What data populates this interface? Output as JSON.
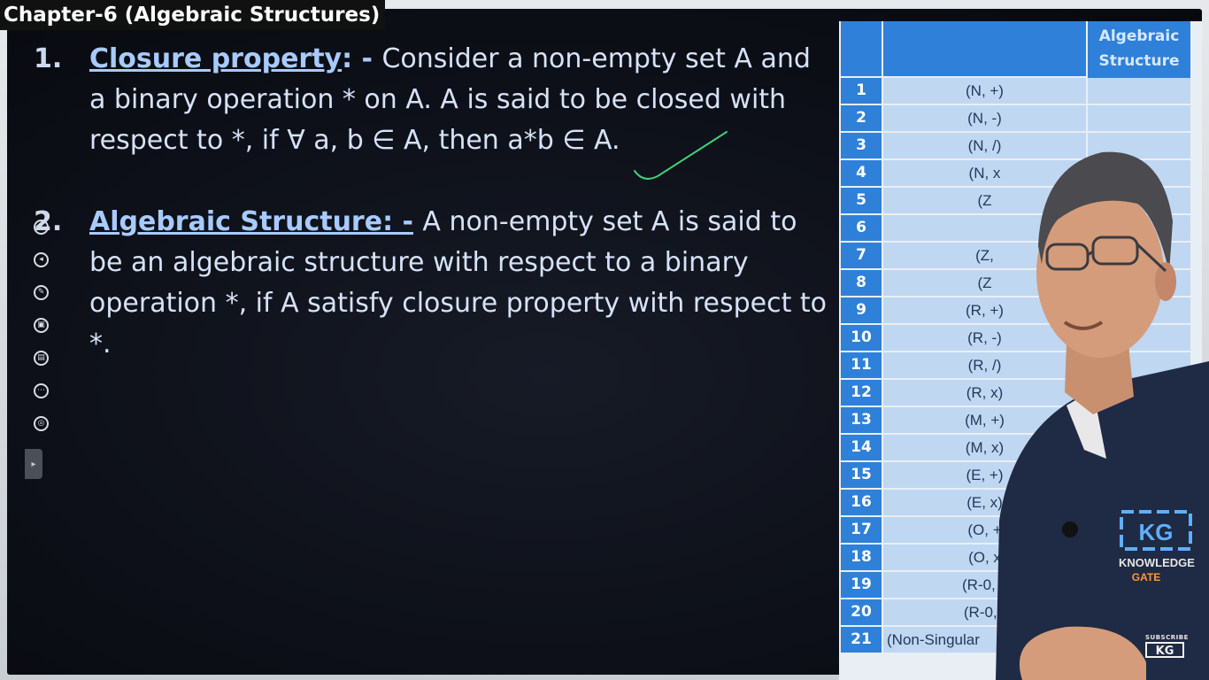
{
  "chapter_title": "Chapter-6 (Algebraic Structures)",
  "items": [
    {
      "number": "1.",
      "term": "Closure property",
      "separator": ": - ",
      "text": "Consider a non-empty set A and a binary operation * on A. A is said to be closed with respect to *, if ∀ a, b ∈ A, then a*b ∈ A."
    },
    {
      "number": "2.",
      "term": "Algebraic Structure: -",
      "separator": " ",
      "text": "A non-empty set A is said to be an algebraic structure with respect to a binary operation *, if A satisfy closure property with respect to *."
    }
  ],
  "table": {
    "header": {
      "num": "",
      "set": "",
      "structure": "Algebraic Structure"
    },
    "rows": [
      {
        "num": "1",
        "set": "(N, +)"
      },
      {
        "num": "2",
        "set": "(N, -)"
      },
      {
        "num": "3",
        "set": "(N, /)"
      },
      {
        "num": "4",
        "set": "(N, x"
      },
      {
        "num": "5",
        "set": "(Z"
      },
      {
        "num": "6",
        "set": ""
      },
      {
        "num": "7",
        "set": "(Z,"
      },
      {
        "num": "8",
        "set": "(Z"
      },
      {
        "num": "9",
        "set": "(R, +)"
      },
      {
        "num": "10",
        "set": "(R, -)"
      },
      {
        "num": "11",
        "set": "(R, /)"
      },
      {
        "num": "12",
        "set": "(R, x)"
      },
      {
        "num": "13",
        "set": "(M, +)"
      },
      {
        "num": "14",
        "set": "(M, x)"
      },
      {
        "num": "15",
        "set": "(E, +)"
      },
      {
        "num": "16",
        "set": "(E, x)"
      },
      {
        "num": "17",
        "set": "(O, +"
      },
      {
        "num": "18",
        "set": "(O, x"
      },
      {
        "num": "19",
        "set": "(R-0, x"
      },
      {
        "num": "20",
        "set": "(R-0, /"
      },
      {
        "num": "21",
        "set": "(Non-Singular"
      }
    ]
  },
  "side_tools": [
    "pointer-tool-icon",
    "back-arrow-icon",
    "pen-icon",
    "screenshot-icon",
    "image-icon",
    "more-icon",
    "web-icon"
  ],
  "presenter": {
    "logo_text": "KG",
    "brand_line1": "KNOWLEDGE",
    "brand_line2": "GATE"
  },
  "subscribe": {
    "label": "SUBSCRIBE",
    "logo": "KG"
  },
  "colors": {
    "screen_bg": "#0d1018",
    "text": "#d6e2f7",
    "term": "#a8cbff",
    "table_header": "#2f80d8",
    "table_cell": "#bfd7f1",
    "checkmark": "#3fd17a",
    "shirt": "#1f2a44"
  }
}
